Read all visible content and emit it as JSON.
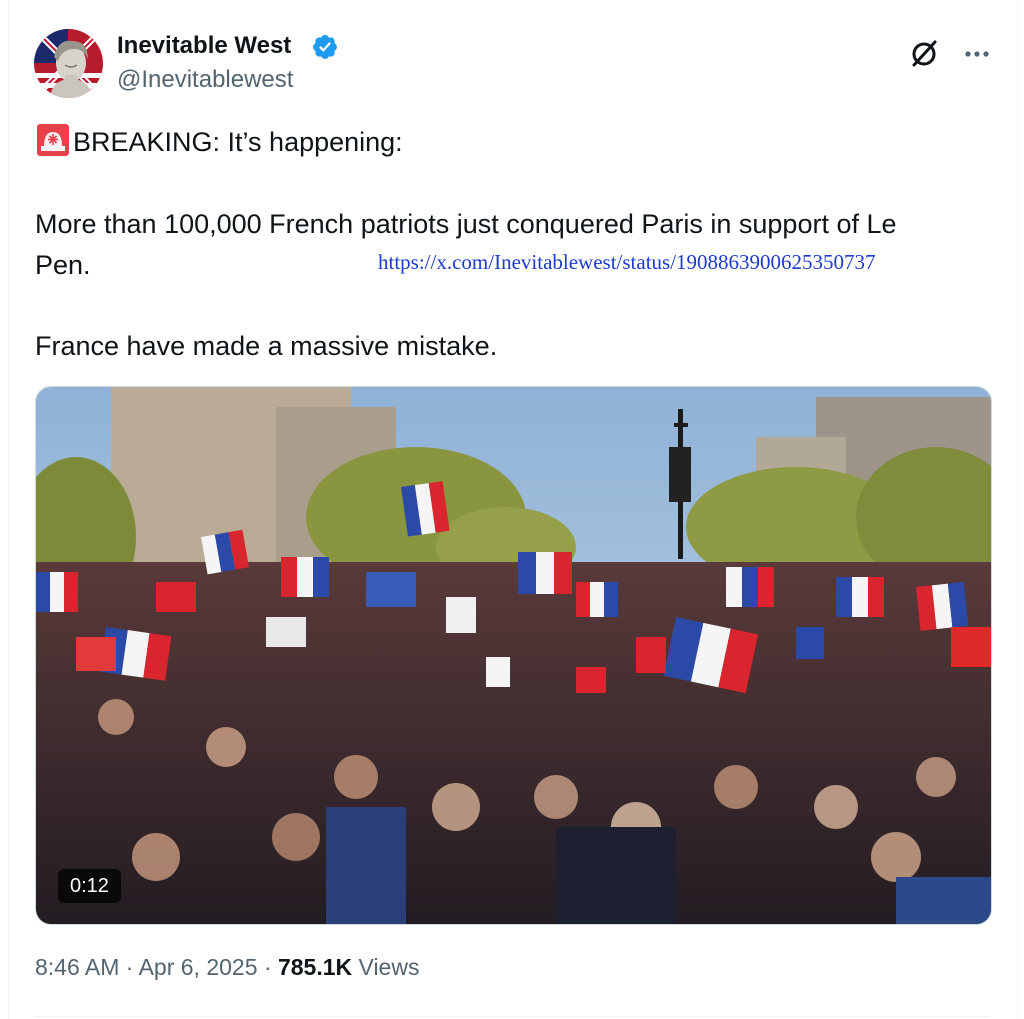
{
  "author": {
    "name": "Inevitable West",
    "handle": "@Inevitablewest",
    "verified": true,
    "avatar_icon": "statue-bust-flag-avatar"
  },
  "header_actions": {
    "grok_icon": "grok-slash-icon",
    "more_icon": "more-dots-icon"
  },
  "tweet": {
    "lines": [
      "BREAKING: It’s happening:",
      "More than 100,000 French patriots just conquered Paris in support of Le",
      "Pen.",
      "France have made a massive mistake."
    ],
    "siren_icon": "rotating-light-emoji",
    "url": "https://x.com/Inevitablewest/status/1908863900625350737"
  },
  "media": {
    "type": "video",
    "duration": "0:12",
    "description_icon": "crowd-with-french-flags"
  },
  "meta": {
    "time": "8:46 AM",
    "separator": "·",
    "date": "Apr 6, 2025",
    "views_count": "785.1K",
    "views_label": "Views"
  },
  "colors": {
    "text": "#0f1419",
    "secondary": "#536471",
    "verified": "#1d9bf0",
    "url": "#1d3ad1",
    "border": "#cfd9de"
  }
}
